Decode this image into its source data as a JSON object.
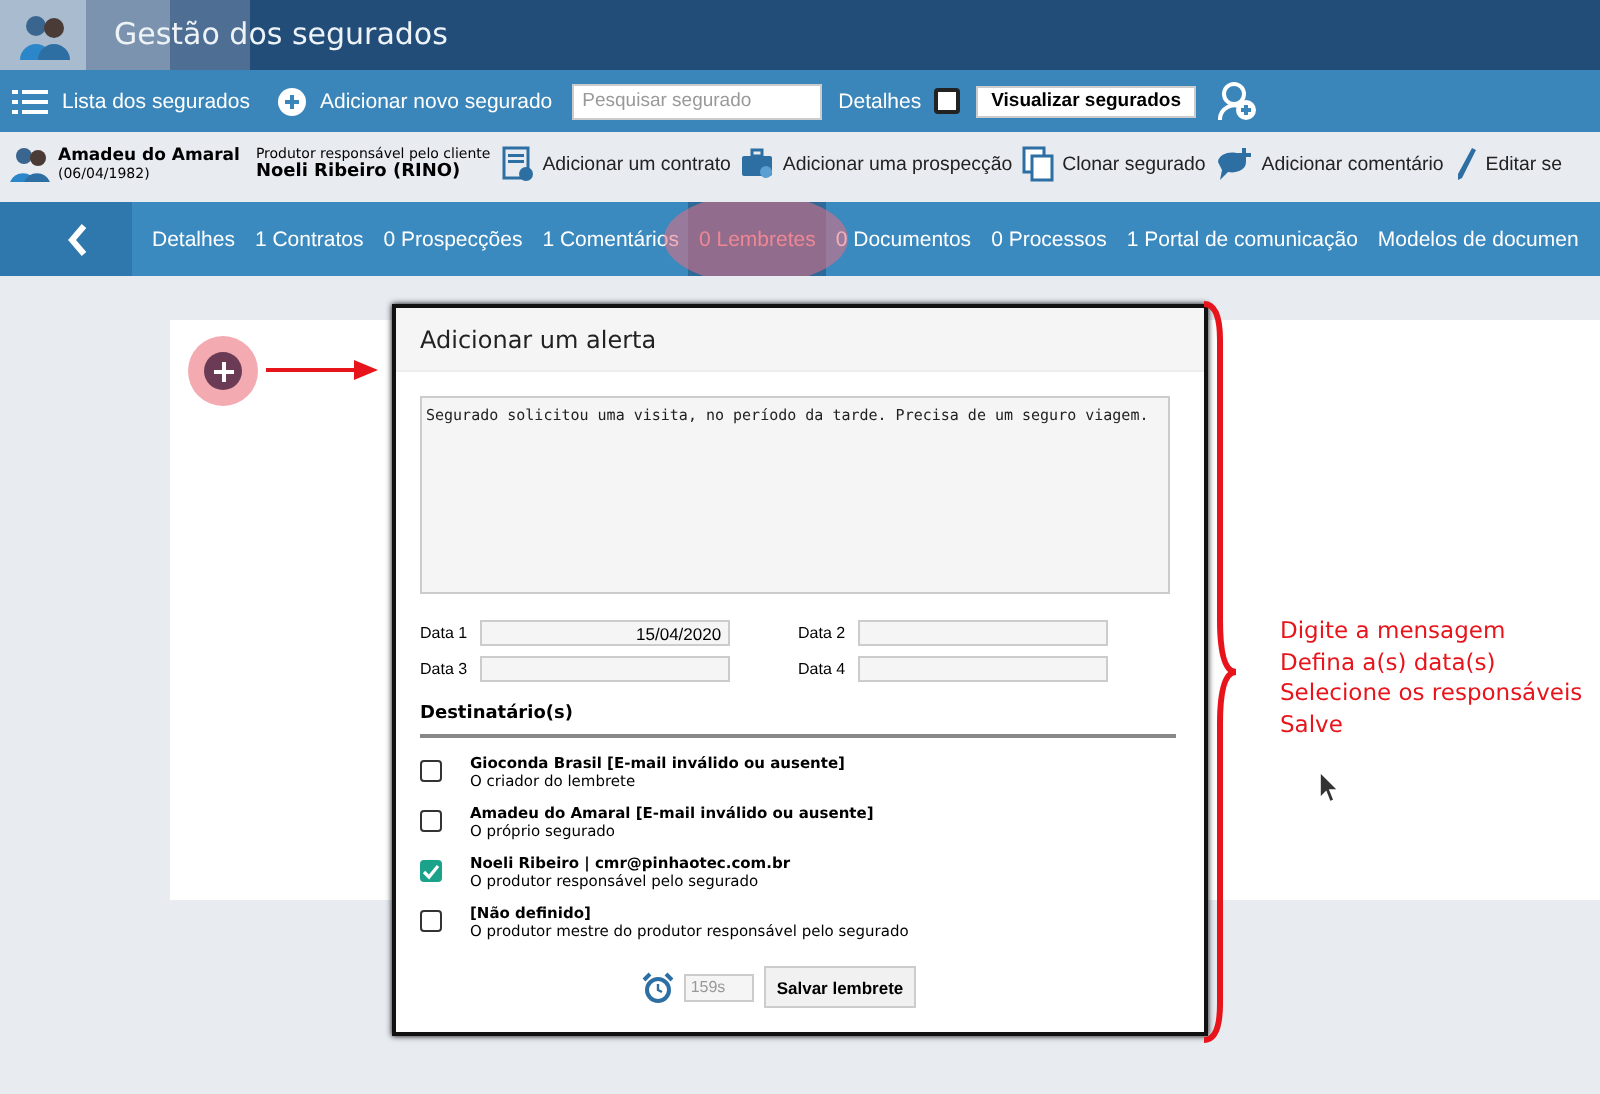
{
  "header": {
    "title": "Gestão dos segurados"
  },
  "toolbar": {
    "items": [
      {
        "kind": "list",
        "label": "Lista dos segurados"
      },
      {
        "kind": "add",
        "label": "Adicionar novo segurado"
      }
    ],
    "search": {
      "placeholder": "Pesquisar segurado"
    },
    "details": {
      "label": "Detalhes",
      "checked": false
    },
    "view_button": "Visualizar segurados"
  },
  "client": {
    "name": "Amadeu do Amaral",
    "birth": "(06/04/1982)",
    "producer_label": "Produtor responsável pelo cliente",
    "producer_name": "Noeli Ribeiro (RINO)",
    "actions": [
      {
        "kind": "contract",
        "label": "Adicionar um contrato"
      },
      {
        "kind": "prospect",
        "label": "Adicionar uma prospecção"
      },
      {
        "kind": "clone",
        "label": "Clonar segurado"
      },
      {
        "kind": "comment",
        "label": "Adicionar comentário"
      },
      {
        "kind": "edit",
        "label": "Editar se"
      }
    ]
  },
  "tabs": [
    {
      "label": "Detalhes",
      "selected": false
    },
    {
      "label": "1 Contratos",
      "selected": false
    },
    {
      "label": "0 Prospecções",
      "selected": false
    },
    {
      "label": "1 Comentários",
      "selected": false
    },
    {
      "label": "0 Lembretes",
      "selected": true
    },
    {
      "label": "0 Documentos",
      "selected": false
    },
    {
      "label": "0 Processos",
      "selected": false
    },
    {
      "label": "1 Portal de comunicação",
      "selected": false
    },
    {
      "label": "Modelos de documen",
      "selected": false
    }
  ],
  "alert": {
    "title": "Adicionar um alerta",
    "message": "Segurado solicitou uma visita, no período da tarde. Precisa de um seguro viagem.",
    "dates": [
      {
        "label": "Data 1",
        "value": "15/04/2020"
      },
      {
        "label": "Data 2"
      },
      {
        "label": "Data 3"
      },
      {
        "label": "Data 4"
      }
    ],
    "recipients_title": "Destinatário(s)",
    "recipients": [
      {
        "name": "Gioconda Brasil [E-mail inválido ou ausente]",
        "description": "O criador do lembrete",
        "checked": false
      },
      {
        "name": "Amadeu do Amaral [E-mail inválido ou ausente]",
        "description": "O próprio segurado",
        "checked": false
      },
      {
        "name": "Noeli Ribeiro | cmr@pinhaotec.com.br",
        "description": "O produtor responsável pelo segurado",
        "checked": true
      },
      {
        "name": "[Não definido]",
        "description": "O produtor mestre do produtor responsável pelo segurado",
        "checked": false
      }
    ],
    "timer": "159s",
    "save_button": "Salvar lembrete"
  },
  "annotation": {
    "lines": [
      "Digite a mensagem",
      "Defina a(s) data(s)",
      "Selecione os responsáveis",
      "Salve"
    ]
  }
}
